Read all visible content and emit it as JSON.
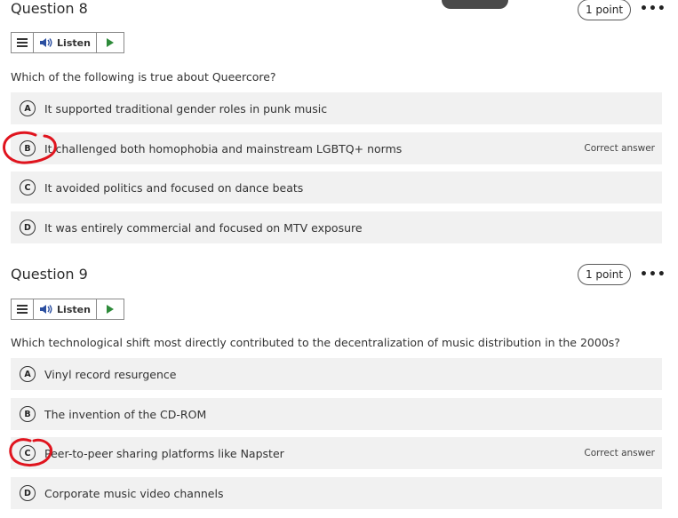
{
  "questions": [
    {
      "title": "Question 8",
      "points": "1 point",
      "more": "•••",
      "listen_label": "Listen",
      "prompt": "Which of the following is true about Queercore?",
      "options": [
        {
          "letter": "A",
          "text": "It supported traditional gender roles in punk music",
          "correct": ""
        },
        {
          "letter": "B",
          "text": "It challenged both homophobia and mainstream LGBTQ+ norms",
          "correct": "Correct answer"
        },
        {
          "letter": "C",
          "text": "It avoided politics and focused on dance beats",
          "correct": ""
        },
        {
          "letter": "D",
          "text": "It was entirely commercial and focused on MTV exposure",
          "correct": ""
        }
      ]
    },
    {
      "title": "Question 9",
      "points": "1 point",
      "more": "•••",
      "listen_label": "Listen",
      "prompt": "Which technological shift most directly contributed to the decentralization of music distribution in the 2000s?",
      "options": [
        {
          "letter": "A",
          "text": "Vinyl record resurgence",
          "correct": ""
        },
        {
          "letter": "B",
          "text": "The invention of the CD-ROM",
          "correct": ""
        },
        {
          "letter": "C",
          "text": "Peer-to-peer sharing platforms like Napster",
          "correct": "Correct answer"
        },
        {
          "letter": "D",
          "text": "Corporate music video channels",
          "correct": ""
        }
      ]
    }
  ],
  "colors": {
    "option_bg": "#f1f1f1",
    "play_green": "#2e8b3a",
    "annotation_red": "#e0141e"
  },
  "icons": {
    "menu": "hamburger-icon",
    "speaker": "speaker-icon",
    "play": "play-icon",
    "more": "more-options-icon"
  }
}
